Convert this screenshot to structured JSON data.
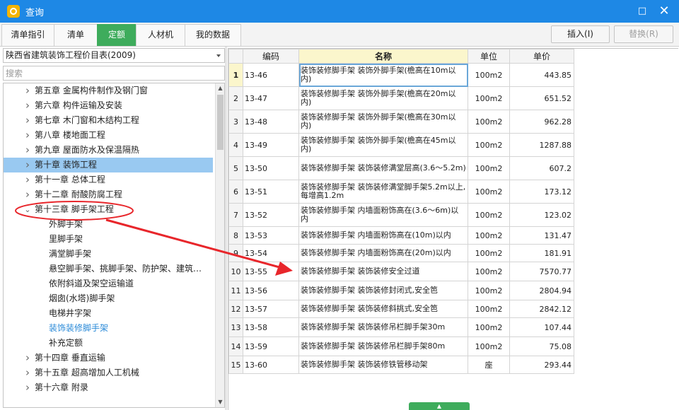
{
  "window": {
    "title": "查询",
    "maximize_glyph": "□",
    "close_glyph": "✕"
  },
  "tabs": [
    "清单指引",
    "清单",
    "定额",
    "人材机",
    "我的数据"
  ],
  "buttons": {
    "insert": "插入(I)",
    "replace": "替换(R)"
  },
  "dropdown": {
    "value": "陕西省建筑装饰工程价目表(2009)"
  },
  "search": {
    "placeholder": "搜索",
    "value": ""
  },
  "tree": [
    {
      "label": "第五章  金属构件制作及钢门窗",
      "level": 1,
      "expanded": false
    },
    {
      "label": "第六章  构件运输及安装",
      "level": 1,
      "expanded": false
    },
    {
      "label": "第七章  木门窗和木结构工程",
      "level": 1,
      "expanded": false
    },
    {
      "label": "第八章  楼地面工程",
      "level": 1,
      "expanded": false
    },
    {
      "label": "第九章  屋面防水及保温隔热",
      "level": 1,
      "expanded": false
    },
    {
      "label": "第十章  装饰工程",
      "level": 1,
      "expanded": false,
      "selected": true
    },
    {
      "label": "第十一章  总体工程",
      "level": 1,
      "expanded": false
    },
    {
      "label": "第十二章  耐酸防腐工程",
      "level": 1,
      "expanded": false
    },
    {
      "label": "第十三章  脚手架工程",
      "level": 1,
      "expanded": true
    },
    {
      "label": "外脚手架",
      "level": 2
    },
    {
      "label": "里脚手架",
      "level": 2
    },
    {
      "label": "满堂脚手架",
      "level": 2
    },
    {
      "label": "悬空脚手架、挑脚手架、防护架、建筑…",
      "level": 2
    },
    {
      "label": "依附斜道及架空运输道",
      "level": 2
    },
    {
      "label": "烟囱(水塔)脚手架",
      "level": 2
    },
    {
      "label": "电梯井字架",
      "level": 2
    },
    {
      "label": "装饰装修脚手架",
      "level": 2,
      "active": true
    },
    {
      "label": "补充定额",
      "level": 2
    },
    {
      "label": "第十四章  垂直运输",
      "level": 1,
      "expanded": false
    },
    {
      "label": "第十五章  超高增加人工机械",
      "level": 1,
      "expanded": false
    },
    {
      "label": "第十六章  附录",
      "level": 1,
      "expanded": false
    }
  ],
  "table": {
    "columns": [
      "",
      "编码",
      "名称",
      "单位",
      "单价"
    ],
    "rows": [
      {
        "n": "1",
        "code": "13-46",
        "name": "装饰装修脚手架 装饰外脚手架(檐高在10m以内)",
        "unit": "100m2",
        "price": "443.85"
      },
      {
        "n": "2",
        "code": "13-47",
        "name": "装饰装修脚手架 装饰外脚手架(檐高在20m以内)",
        "unit": "100m2",
        "price": "651.52"
      },
      {
        "n": "3",
        "code": "13-48",
        "name": "装饰装修脚手架 装饰外脚手架(檐高在30m以内)",
        "unit": "100m2",
        "price": "962.28"
      },
      {
        "n": "4",
        "code": "13-49",
        "name": "装饰装修脚手架 装饰外脚手架(檐高在45m以内)",
        "unit": "100m2",
        "price": "1287.88"
      },
      {
        "n": "5",
        "code": "13-50",
        "name": "装饰装修脚手架 装饰装修满堂层高(3.6～5.2m)",
        "unit": "100m2",
        "price": "607.2"
      },
      {
        "n": "6",
        "code": "13-51",
        "name": "装饰装修脚手架 装饰装修满堂脚手架5.2m以上,每增高1.2m",
        "unit": "100m2",
        "price": "173.12"
      },
      {
        "n": "7",
        "code": "13-52",
        "name": "装饰装修脚手架 内墙面粉饰高在(3.6～6m)以内",
        "unit": "100m2",
        "price": "123.02"
      },
      {
        "n": "8",
        "code": "13-53",
        "name": "装饰装修脚手架 内墙面粉饰高在(10m)以内",
        "unit": "100m2",
        "price": "131.47"
      },
      {
        "n": "9",
        "code": "13-54",
        "name": "装饰装修脚手架 内墙面粉饰高在(20m)以内",
        "unit": "100m2",
        "price": "181.91"
      },
      {
        "n": "10",
        "code": "13-55",
        "name": "装饰装修脚手架 装饰装修安全过道",
        "unit": "100m2",
        "price": "7570.77"
      },
      {
        "n": "11",
        "code": "13-56",
        "name": "装饰装修脚手架 装饰装修封闭式,安全笆",
        "unit": "100m2",
        "price": "2804.94"
      },
      {
        "n": "12",
        "code": "13-57",
        "name": "装饰装修脚手架 装饰装修斜挑式,安全笆",
        "unit": "100m2",
        "price": "2842.12"
      },
      {
        "n": "13",
        "code": "13-58",
        "name": "装饰装修脚手架 装饰装修吊栏脚手架30m",
        "unit": "100m2",
        "price": "107.44"
      },
      {
        "n": "14",
        "code": "13-59",
        "name": "装饰装修脚手架 装饰装修吊栏脚手架80m",
        "unit": "100m2",
        "price": "75.08"
      },
      {
        "n": "15",
        "code": "13-60",
        "name": "装饰装修脚手架 装饰装修铁管移动架",
        "unit": "座",
        "price": "293.44"
      }
    ]
  },
  "colors": {
    "titlebar": "#1e88e5",
    "active_tab": "#3eac5c",
    "selected_tree": "#99c9f1",
    "annotation": "#e8262b",
    "link": "#2a8ad8"
  },
  "icons": {
    "app": "search-app-icon",
    "expand": "chevron-right-icon",
    "collapse": "chevron-down-icon"
  }
}
